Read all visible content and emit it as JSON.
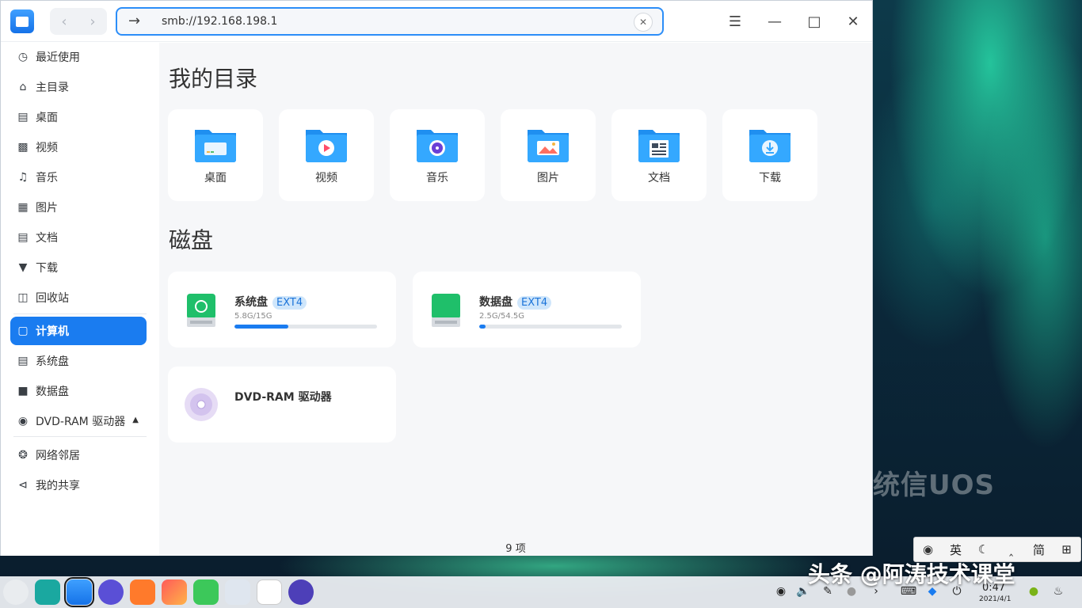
{
  "window": {
    "address": "smb://192.168.198.1",
    "clear_icon": "close-icon"
  },
  "sidebar": {
    "items": [
      {
        "label": "最近使用",
        "icon": "clock-icon"
      },
      {
        "label": "主目录",
        "icon": "home-icon"
      },
      {
        "label": "桌面",
        "icon": "desktop-icon"
      },
      {
        "label": "视频",
        "icon": "video-icon"
      },
      {
        "label": "音乐",
        "icon": "music-icon"
      },
      {
        "label": "图片",
        "icon": "picture-icon"
      },
      {
        "label": "文档",
        "icon": "document-icon"
      },
      {
        "label": "下载",
        "icon": "download-icon"
      },
      {
        "label": "回收站",
        "icon": "trash-icon"
      },
      {
        "label": "计算机",
        "icon": "computer-icon",
        "active": true
      },
      {
        "label": "系统盘",
        "icon": "disk-icon"
      },
      {
        "label": "数据盘",
        "icon": "disk-icon"
      },
      {
        "label": "DVD-RAM 驱动器",
        "icon": "dvd-icon"
      },
      {
        "label": "网络邻居",
        "icon": "network-icon"
      },
      {
        "label": "我的共享",
        "icon": "share-icon"
      }
    ]
  },
  "main": {
    "my_dirs_title": "我的目录",
    "folders": [
      {
        "label": "桌面",
        "icon": "desktop-folder-icon"
      },
      {
        "label": "视频",
        "icon": "video-folder-icon"
      },
      {
        "label": "音乐",
        "icon": "music-folder-icon"
      },
      {
        "label": "图片",
        "icon": "picture-folder-icon"
      },
      {
        "label": "文档",
        "icon": "document-folder-icon"
      },
      {
        "label": "下载",
        "icon": "download-folder-icon"
      }
    ],
    "disks_title": "磁盘",
    "disks": [
      {
        "name": "系统盘",
        "fs": "EXT4",
        "usage": "5.8G/15G",
        "fill": 0.38
      },
      {
        "name": "数据盘",
        "fs": "EXT4",
        "usage": "2.5G/54.5G",
        "fill": 0.046
      }
    ],
    "dvd": {
      "name": "DVD-RAM 驱动器"
    },
    "status": "9 项"
  },
  "ime": {
    "items": [
      "英",
      "简"
    ]
  },
  "dock": {
    "time": "0:47",
    "date": "2021/4/1"
  },
  "watermark": "头条 @阿涛技术课堂",
  "wallpaper_logo": "统信UOS"
}
